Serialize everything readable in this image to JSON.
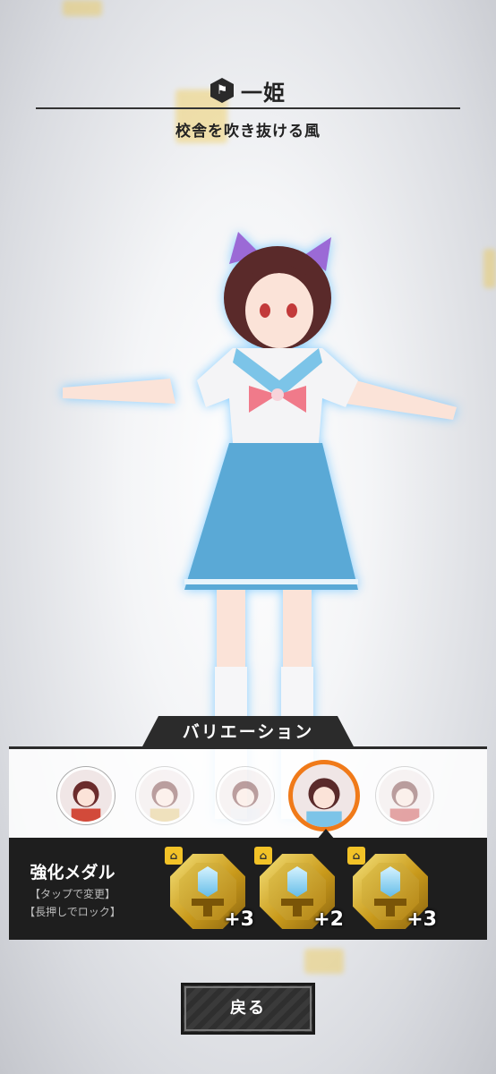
{
  "character": {
    "name": "一姫",
    "outfit": "校舎を吹き抜ける風",
    "icon": "character-hex-icon"
  },
  "variation": {
    "tab_label": "バリエーション",
    "items": [
      {
        "label": "variation-1",
        "state": "normal"
      },
      {
        "label": "variation-2",
        "state": "dim"
      },
      {
        "label": "variation-3",
        "state": "dim"
      },
      {
        "label": "variation-4",
        "state": "selected"
      },
      {
        "label": "variation-5",
        "state": "dim"
      }
    ]
  },
  "medals": {
    "title": "強化メダル",
    "hint_tap": "【タップで変更】",
    "hint_hold": "【長押しでロック】",
    "items": [
      {
        "level": "+3",
        "locked": true
      },
      {
        "level": "+2",
        "locked": true
      },
      {
        "level": "+3",
        "locked": true
      }
    ]
  },
  "buttons": {
    "back": "戻る"
  },
  "colors": {
    "accent_orange": "#f07a19",
    "medal_gold": "#d4a72c",
    "panel_dark": "#1e1e1e"
  }
}
